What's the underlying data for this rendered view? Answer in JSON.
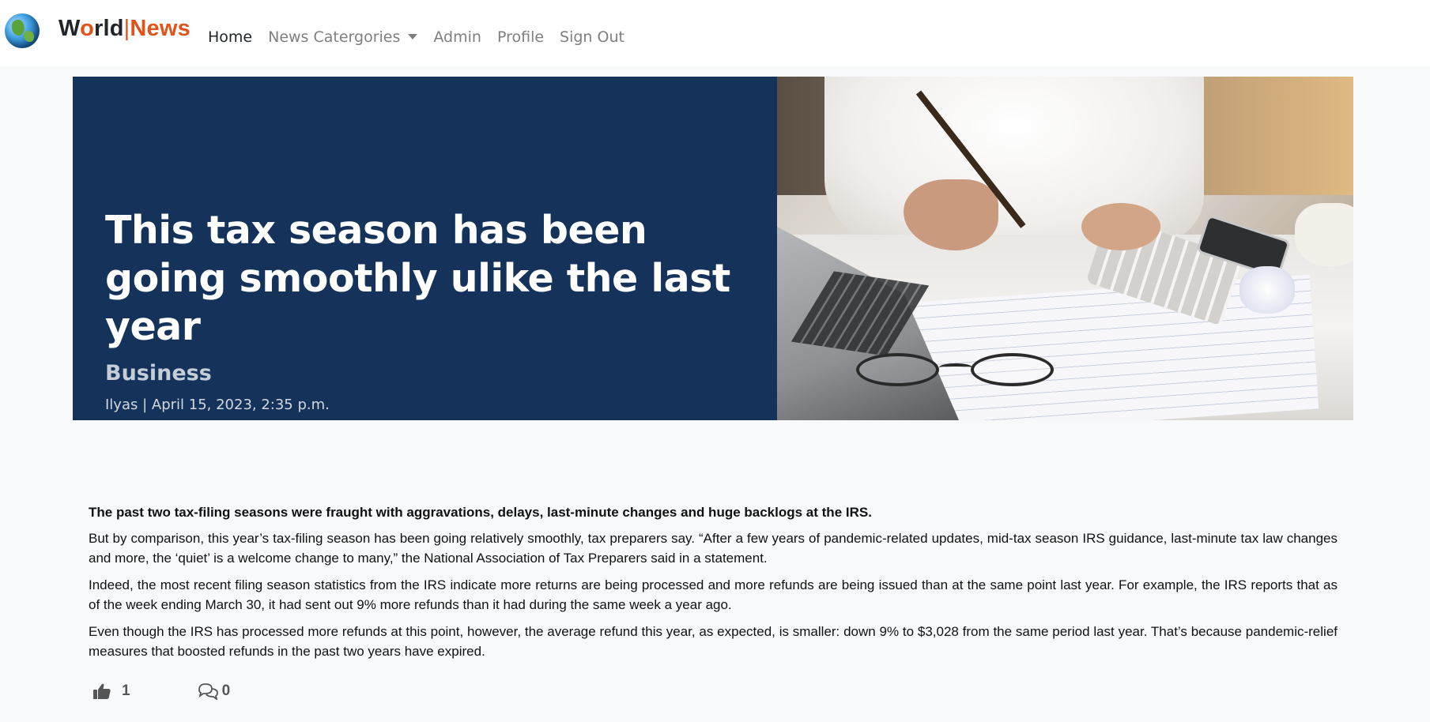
{
  "brand": {
    "part1": "W",
    "part2": "o",
    "part3": "rld",
    "separator": "|",
    "part4": "News"
  },
  "nav": {
    "items": [
      {
        "label": "Home",
        "active": true
      },
      {
        "label": "News Catergories",
        "dropdown": true
      },
      {
        "label": "Admin"
      },
      {
        "label": "Profile"
      },
      {
        "label": "Sign Out"
      }
    ]
  },
  "hero": {
    "title": "This tax season has been going smoothly ulike the last year",
    "category": "Business",
    "meta": "Ilyas | April 15, 2023, 2:35 p.m.",
    "image_icon": "tax-desk-photo"
  },
  "article": {
    "lead": "The past two tax-filing seasons were fraught with aggravations, delays, last-minute changes and huge backlogs at the IRS.",
    "paragraphs": [
      "But by comparison, this year’s tax-filing season has been going relatively smoothly, tax preparers say. “After a few years of pandemic-related updates, mid-tax season IRS guidance, last-minute tax law changes and more, the ‘quiet’ is a welcome change to many,” the National Association of Tax Preparers said in a statement.",
      "Indeed, the most recent filing season statistics from the IRS indicate more returns are being processed and more refunds are being issued than at the same point last year. For example, the IRS reports that as of the week ending March 30, it had sent out 9% more refunds than it had during the same week a year ago.",
      "Even though the IRS has processed more refunds at this point, however, the average refund this year, as expected, is smaller: down 9% to $3,028 from the same period last year. That’s because pandemic-relief measures that boosted refunds in the past two years have expired."
    ]
  },
  "actions": {
    "likes": "1",
    "comments": "0"
  },
  "colors": {
    "hero_bg": "#14325a",
    "brand_accent": "#e0541b",
    "page_bg": "#f8f9fa"
  }
}
